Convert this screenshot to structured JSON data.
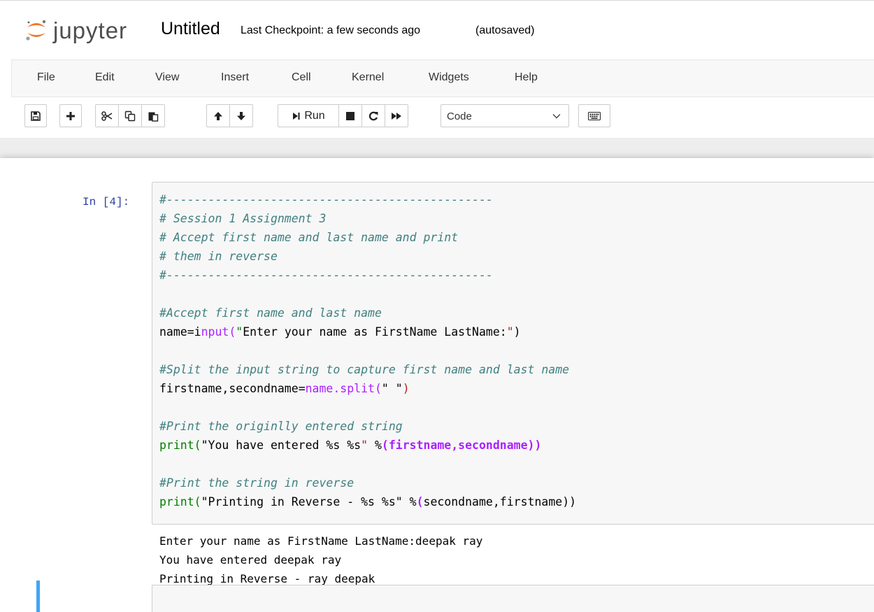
{
  "header": {
    "logo_text": "jupyter",
    "notebook_name": "Untitled",
    "checkpoint": "Last Checkpoint: a few seconds ago",
    "autosave": "(autosaved)"
  },
  "menu": [
    "File",
    "Edit",
    "View",
    "Insert",
    "Cell",
    "Kernel",
    "Widgets",
    "Help"
  ],
  "toolbar": {
    "run_label": "Run",
    "cell_type": "Code",
    "icons": [
      "save-icon",
      "plus-icon",
      "cut-icon",
      "copy-icon",
      "paste-icon",
      "arrow-up-icon",
      "arrow-down-icon",
      "run-icon",
      "stop-icon",
      "restart-icon",
      "fast-forward-icon",
      "chevron-down-icon",
      "keyboard-icon"
    ]
  },
  "cell": {
    "prompt": "In [4]:",
    "code_lines": [
      "#-----------------------------------------------",
      "# Session 1 Assignment 3",
      "# Accept first name and last name and print",
      "# them in reverse",
      "#-----------------------------------------------",
      "",
      "#Accept first name and last name",
      "name=input(\"Enter your name as FirstName LastName:\")",
      "",
      "#Split the input string to capture first name and last name",
      "firstname,secondname=name.split(\" \")",
      "",
      "#Print the originlly entered string",
      "print(\"You have entered %s %s\" %(firstname,secondname))",
      "",
      "#Print the string in reverse",
      "print(\"Printing in Reverse - %s %s\" %(secondname,firstname))"
    ],
    "output_lines": [
      "Enter your name as FirstName LastName:deepak ray",
      "You have entered deepak ray",
      "Printing in Reverse - ray deepak"
    ]
  },
  "colors": {
    "prompt": "#303f9f",
    "comment": "#408080",
    "builtin": "#008000",
    "string": "#ba2121",
    "operator": "#aa22ff",
    "selected_cell_border": "#42a5f5"
  }
}
